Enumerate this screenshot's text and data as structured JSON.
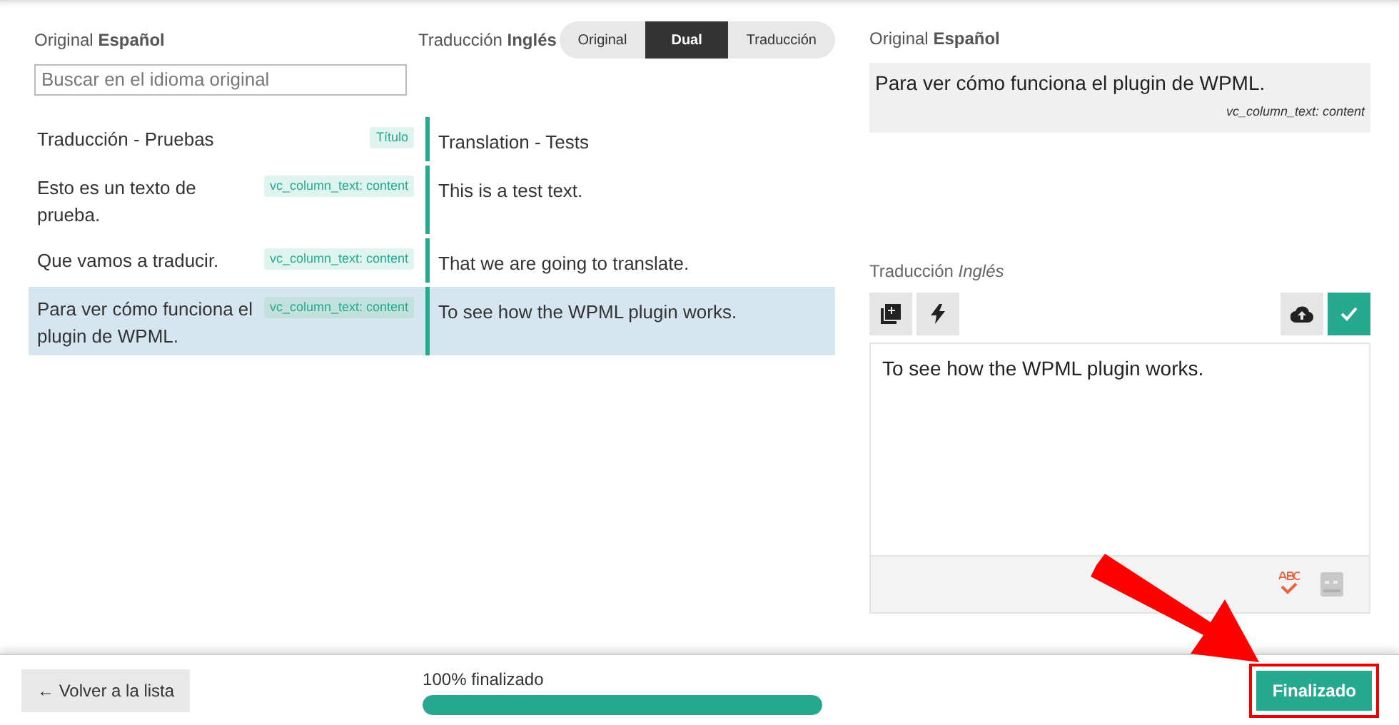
{
  "left_header": {
    "original_label": "Original **Español**",
    "translation_label": "Traducción **Inglés**"
  },
  "view_toggle": [
    {
      "label": "Original",
      "selected": false
    },
    {
      "label": "Dual",
      "selected": true
    },
    {
      "label": "Traducción",
      "selected": false
    }
  ],
  "search": {
    "placeholder": "Buscar en el idioma original"
  },
  "rows": [
    {
      "original": "Traducción - Pruebas",
      "tag": "Título",
      "translation": "Translation - Tests",
      "selected": false
    },
    {
      "original": "Esto es un texto de prueba.",
      "tag": "vc_column_text: content",
      "translation": "This is a test text.",
      "selected": false
    },
    {
      "original": "Que vamos a traducir.",
      "tag": "vc_column_text: content",
      "translation": "That we are going to translate.",
      "selected": false
    },
    {
      "original": "Para ver cómo funciona el plugin de WPML.",
      "tag": "vc_column_text: content",
      "translation": "To see how the WPML plugin works.",
      "selected": true
    }
  ],
  "detail": {
    "original_label": "Original **Español**",
    "original_text": "Para ver cómo funciona el plugin de WPML.",
    "field_name": "vc_column_text: content",
    "translation_label": "Traducción *Inglés*",
    "translation_value": "To see how the WPML plugin works."
  },
  "footer": {
    "back_button": "← Volver a la lista",
    "progress_label": "100% finalizado",
    "progress": {
      "level": 1
    },
    "finish_button": "Finalizado"
  }
}
